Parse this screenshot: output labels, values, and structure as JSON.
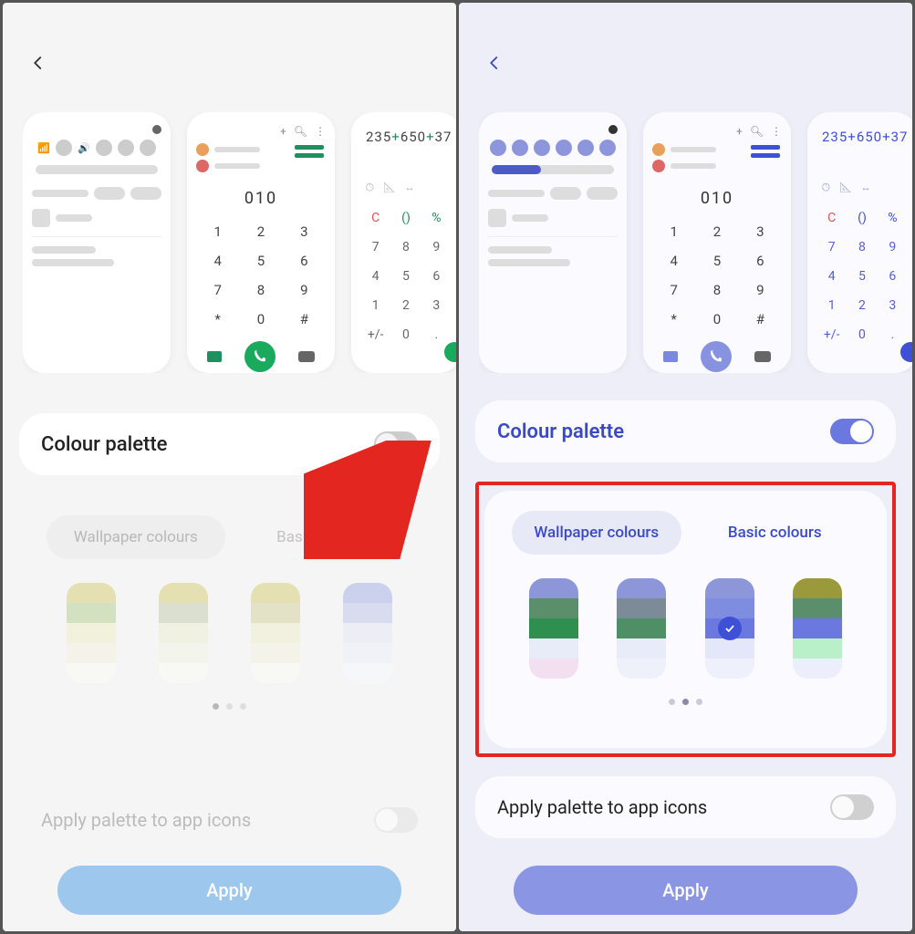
{
  "left": {
    "back_icon": "chevron-left",
    "accent": "#1f8f5f",
    "previews": {
      "dialer_number": "010",
      "dialer_keys": [
        "1",
        "2",
        "3",
        "4",
        "5",
        "6",
        "7",
        "8",
        "9",
        "*",
        "0",
        "#"
      ],
      "calc_expr_parts": [
        "235",
        "+",
        "650",
        "+",
        "37"
      ],
      "calc_row1": [
        "C",
        "()",
        "%"
      ],
      "calc_nums": [
        "7",
        "8",
        "9",
        "4",
        "5",
        "6",
        "1",
        "2",
        "3",
        "+/-",
        "0",
        "."
      ]
    },
    "colour_palette": {
      "title": "Colour palette",
      "enabled": false,
      "tabs": {
        "wallpaper": "Wallpaper colours",
        "basic": "Basic colours",
        "selected": "wallpaper"
      },
      "swatches": [
        [
          "#d9cf7a",
          "#b9d196",
          "#f0eec9",
          "#f4f3e0",
          "#fbfbf4"
        ],
        [
          "#d9cf7a",
          "#c7ceb3",
          "#efeed4",
          "#f3f4e6",
          "#fbfbf6"
        ],
        [
          "#d9cf7a",
          "#d6d2a1",
          "#f0eed0",
          "#f4f3e2",
          "#fbfbf5"
        ],
        [
          "#a9b4e6",
          "#c2c9ea",
          "#e5e8f6",
          "#eef0fa",
          "#f8f9fd"
        ]
      ],
      "selected_index": null,
      "pager": {
        "count": 3,
        "active": 0
      }
    },
    "apply_icons": {
      "label": "Apply palette to app icons",
      "enabled": false
    },
    "apply_button": "Apply",
    "annotation": {
      "arrow_to": "colour-palette-toggle"
    }
  },
  "right": {
    "back_icon": "chevron-left",
    "accent": "#3d50d6",
    "previews": {
      "dialer_number": "010",
      "dialer_keys": [
        "1",
        "2",
        "3",
        "4",
        "5",
        "6",
        "7",
        "8",
        "9",
        "*",
        "0",
        "#"
      ],
      "calc_expr_parts": [
        "235",
        "+",
        "650",
        "+",
        "37"
      ],
      "calc_row1": [
        "C",
        "()",
        "%"
      ],
      "calc_nums": [
        "7",
        "8",
        "9",
        "4",
        "5",
        "6",
        "1",
        "2",
        "3",
        "+/-",
        "0",
        "."
      ]
    },
    "colour_palette": {
      "title": "Colour palette",
      "enabled": true,
      "tabs": {
        "wallpaper": "Wallpaper colours",
        "basic": "Basic colours",
        "selected": "wallpaper"
      },
      "swatches": [
        [
          "#8c96d9",
          "#5b8f6b",
          "#2f8f4f",
          "#e8ebf8",
          "#f2dff0"
        ],
        [
          "#8c96d9",
          "#7d8a97",
          "#4f8f66",
          "#e8ebf8",
          "#eef0fa"
        ],
        [
          "#8c96d9",
          "#7f8de0",
          "#6a78e0",
          "#e3e7f9",
          "#eef0fb"
        ],
        [
          "#9a9a3d",
          "#5b8f6b",
          "#6a78e0",
          "#b9f0c9",
          "#eceefb"
        ]
      ],
      "selected_index": 2,
      "pager": {
        "count": 3,
        "active": 1
      }
    },
    "apply_icons": {
      "label": "Apply palette to app icons",
      "enabled": false
    },
    "apply_button": "Apply",
    "highlight_box": true
  }
}
